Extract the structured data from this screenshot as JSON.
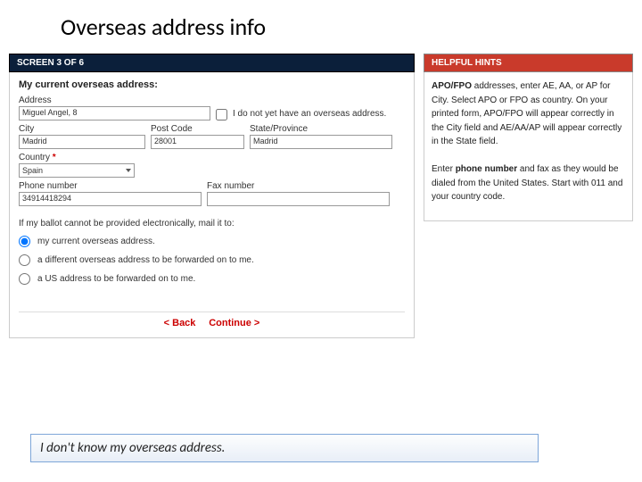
{
  "slide_title": "Overseas address info",
  "screen_bar": "SCREEN 3 OF 6",
  "hints_bar": "HELPFUL HINTS",
  "form": {
    "heading": "My current overseas address:",
    "labels": {
      "address": "Address",
      "city": "City",
      "post_code": "Post Code",
      "state": "State/Province",
      "country": "Country",
      "phone": "Phone number",
      "fax": "Fax number",
      "asterisk": "*"
    },
    "values": {
      "address": "Miguel Angel, 8",
      "city": "Madrid",
      "post_code": "28001",
      "state": "Madrid",
      "country": "Spain",
      "phone": "34914418294",
      "fax": ""
    },
    "no_address": {
      "label": "I do not yet have an overseas address."
    },
    "radio": {
      "prompt": "If my ballot cannot be provided electronically, mail it to:",
      "options": [
        "my current overseas address.",
        "a different overseas address to be forwarded on to me.",
        "a US address to be forwarded on to me."
      ],
      "selected_index": 0
    },
    "nav": {
      "back": "< Back",
      "continue": "Continue >"
    }
  },
  "hints": {
    "p1_a": "APO/FPO",
    "p1_b": " addresses, enter AE, AA, or AP for City. Select APO or FPO as country. On your printed form, APO/FPO will appear correctly in the City field and AE/AA/AP will appear correctly in the State field.",
    "p2_a": "Enter ",
    "p2_b": "phone number",
    "p2_c": " and fax as they would be dialed from the United States. Start with 011 and your country code."
  },
  "note": "I don't know my overseas address."
}
